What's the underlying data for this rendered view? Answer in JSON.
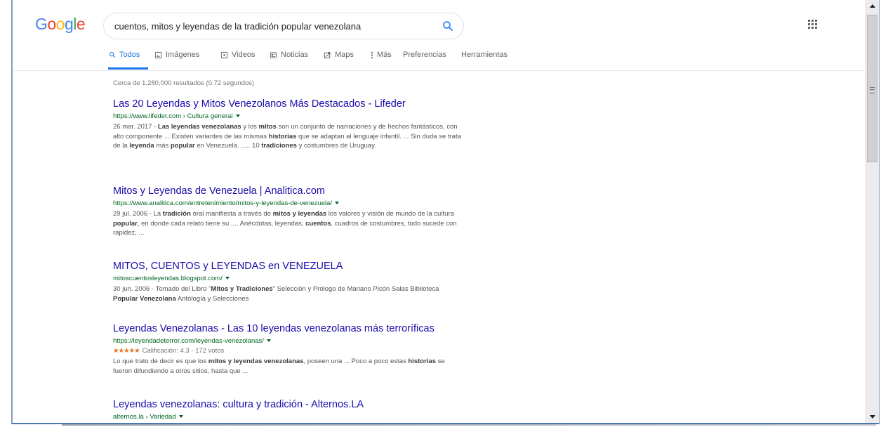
{
  "logo": {
    "letters": [
      {
        "ch": "G",
        "color": "#4285f4"
      },
      {
        "ch": "o",
        "color": "#ea4335"
      },
      {
        "ch": "o",
        "color": "#fbbc05"
      },
      {
        "ch": "g",
        "color": "#4285f4"
      },
      {
        "ch": "l",
        "color": "#34a853"
      },
      {
        "ch": "e",
        "color": "#ea4335"
      }
    ]
  },
  "search": {
    "query": "cuentos, mitos y leyendas de la tradición popular venezolana",
    "icon": "search-icon"
  },
  "tabs": [
    {
      "label": "Todos",
      "icon": "search-icon",
      "active": true
    },
    {
      "label": "Imágenes",
      "icon": "image-icon"
    },
    {
      "label": "Videos",
      "icon": "video-icon"
    },
    {
      "label": "Noticias",
      "icon": "news-icon"
    },
    {
      "label": "Maps",
      "icon": "map-icon"
    },
    {
      "label": "Más",
      "icon": "more-vertical-icon"
    },
    {
      "label": "Preferencias"
    },
    {
      "label": "Herramientas"
    }
  ],
  "stats": "Cerca de 1,280,000 resultados (0.72 segundos)",
  "results": [
    {
      "title": "Las 20 Leyendas y Mitos Venezolanos Más Destacados - Lifeder",
      "url": "https://www.lifeder.com › Cultura general",
      "snippet_html": "26 mar. 2017 - <b>Las leyendas venezolanas</b> y los <b>mitos</b> son un conjunto de narraciones y de hechos fantásticos, con alto componente ... Existen variantes de las mismas <b>historias</b> que se adaptan al lenguaje infantil. ... Sin duda se trata de la <b>leyenda</b> más <b>popular</b> en Venezuela. ..... 10 <b>tradiciones</b> y costumbres de Uruguay."
    },
    {
      "title": "Mitos y Leyendas de Venezuela | Analitica.com",
      "url": "https://www.analitica.com/entretenimiento/mitos-y-leyendas-de-venezuela/",
      "snippet_html": "29 jul. 2006 - La <b>tradición</b> oral manifiesta a través de <b>mitos y leyendas</b> los valores y visión de mundo de la cultura <b>popular</b>, en donde cada relato tiene su .... Anécdotas, leyendas, <b>cuentos</b>, cuadros de costumbres, todo sucede con rapidez, ..."
    },
    {
      "title": "MITOS, CUENTOS y LEYENDAS en VENEZUELA",
      "url": "mitoscuentosleyendas.blogspot.com/",
      "snippet_html": "30 jun. 2006 - Tomado del Libro \"<b>Mitos y Tradiciones</b>\" Selección y Prólogo de Mariano Picón Salas Biblioteca <b>Popular Venezolana</b> Antología y Selecciones"
    },
    {
      "title": "Leyendas Venezolanas - Las 10 leyendas venezolanas más terroríficas",
      "url": "https://leyendadeterror.com/leyendas-venezolanas/",
      "rating": {
        "stars": "★★★★★",
        "text": "Calificación: 4.3 - 172 votos",
        "value": 4.3
      },
      "snippet_html": "Lo que trato de decir es que los <b>mitos y leyendas venezolanas</b>, poseen una ... Poco a poco estas <b>historias</b> se fueron difundiendo a otros sitios, hasta que ..."
    },
    {
      "title": "Leyendas venezolanas: cultura y tradición - Alternos.LA",
      "url": "alternos.la › Variedad",
      "snippet_html": ""
    }
  ],
  "colors": {
    "link": "#1a0dab",
    "url": "#006621",
    "accent": "#1a73e8",
    "snippet": "#545454"
  }
}
